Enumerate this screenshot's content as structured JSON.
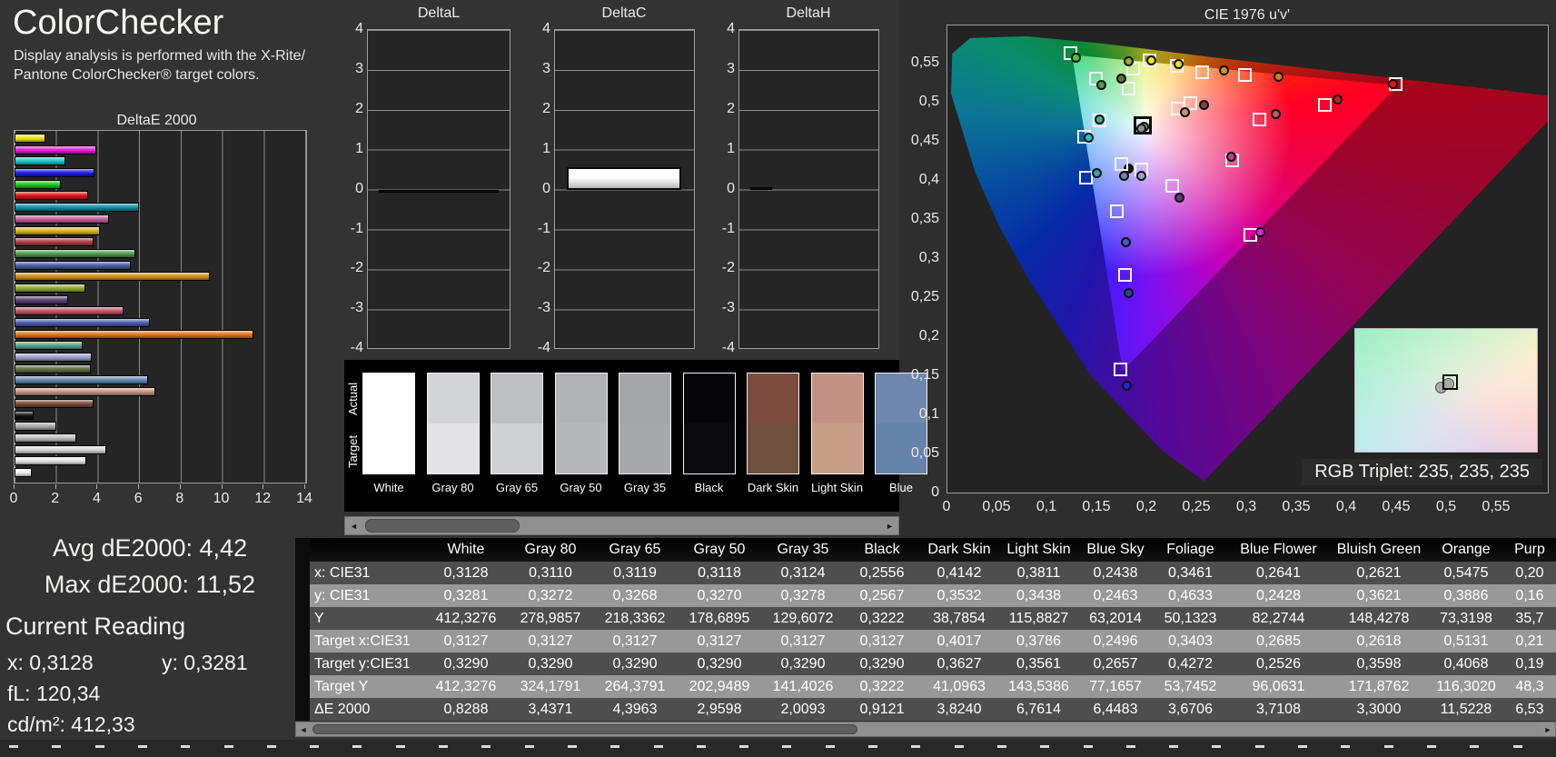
{
  "header": {
    "title": "ColorChecker",
    "subtitle_line1": "Display analysis is performed with the X-Rite/",
    "subtitle_line2": "Pantone ColorChecker® target colors."
  },
  "readings": {
    "avg": "Avg dE2000: 4,42",
    "max": "Max dE2000: 11,52",
    "current_title": "Current Reading",
    "x": "x: 0,3128",
    "y": "y: 0,3281",
    "fl": "fL: 120,34",
    "cd": "cd/m²: 412,33"
  },
  "icons": {
    "scroll_left": "◄",
    "scroll_right": "►"
  },
  "cie": {
    "title": "CIE 1976 u'v'",
    "rgb_triplet": "RGB Triplet: 235, 235, 235"
  },
  "swatch_strip": {
    "actual_label": "Actual",
    "target_label": "Target",
    "items": [
      {
        "name": "White",
        "actual": "#fefefe",
        "target": "#fdfdfd"
      },
      {
        "name": "Gray 80",
        "actual": "#d3d4d6",
        "target": "#e3e3e5"
      },
      {
        "name": "Gray 65",
        "actual": "#bdbfc1",
        "target": "#d0d1d3"
      },
      {
        "name": "Gray 50",
        "actual": "#b1b2b4",
        "target": "#b6b7b9"
      },
      {
        "name": "Gray 35",
        "actual": "#a4a5a7",
        "target": "#a8a9ab"
      },
      {
        "name": "Black",
        "actual": "#060608",
        "target": "#0b0b0d"
      },
      {
        "name": "Dark Skin",
        "actual": "#7d4a3e",
        "target": "#6f503f"
      },
      {
        "name": "Light Skin",
        "actual": "#c29184",
        "target": "#c99e88"
      },
      {
        "name": "Blue",
        "actual": "#6d87ae",
        "target": "#6583ab"
      }
    ]
  },
  "table": {
    "headers": [
      "White",
      "Gray 80",
      "Gray 65",
      "Gray 50",
      "Gray 35",
      "Black",
      "Dark Skin",
      "Light Skin",
      "Blue Sky",
      "Foliage",
      "Blue Flower",
      "Bluish Green",
      "Orange",
      "Purp"
    ],
    "rows": [
      {
        "label": "x: CIE31",
        "values": [
          "0,3128",
          "0,3110",
          "0,3119",
          "0,3118",
          "0,3124",
          "0,2556",
          "0,4142",
          "0,3811",
          "0,2438",
          "0,3461",
          "0,2641",
          "0,2621",
          "0,5475",
          "0,20"
        ]
      },
      {
        "label": "y: CIE31",
        "values": [
          "0,3281",
          "0,3272",
          "0,3268",
          "0,3270",
          "0,3278",
          "0,2567",
          "0,3532",
          "0,3438",
          "0,2463",
          "0,4633",
          "0,2428",
          "0,3621",
          "0,3886",
          "0,16"
        ]
      },
      {
        "label": "Y",
        "values": [
          "412,3276",
          "278,9857",
          "218,3362",
          "178,6895",
          "129,6072",
          "0,3222",
          "38,7854",
          "115,8827",
          "63,2014",
          "50,1323",
          "82,2744",
          "148,4278",
          "73,3198",
          "35,7"
        ]
      },
      {
        "label": "Target x:CIE31",
        "values": [
          "0,3127",
          "0,3127",
          "0,3127",
          "0,3127",
          "0,3127",
          "0,3127",
          "0,4017",
          "0,3786",
          "0,2496",
          "0,3403",
          "0,2685",
          "0,2618",
          "0,5131",
          "0,21"
        ]
      },
      {
        "label": "Target y:CIE31",
        "values": [
          "0,3290",
          "0,3290",
          "0,3290",
          "0,3290",
          "0,3290",
          "0,3290",
          "0,3627",
          "0,3561",
          "0,2657",
          "0,4272",
          "0,2526",
          "0,3598",
          "0,4068",
          "0,19"
        ]
      },
      {
        "label": "Target Y",
        "values": [
          "412,3276",
          "324,1791",
          "264,3791",
          "202,9489",
          "141,4026",
          "0,3222",
          "41,0963",
          "143,5386",
          "77,1657",
          "53,7452",
          "96,0631",
          "171,8762",
          "116,3020",
          "48,3"
        ]
      },
      {
        "label": "ΔE 2000",
        "values": [
          "0,8288",
          "3,4371",
          "4,3963",
          "2,9598",
          "2,0093",
          "0,9121",
          "3,8240",
          "6,7614",
          "6,4483",
          "3,6706",
          "3,7108",
          "3,3000",
          "11,5228",
          "6,53"
        ]
      }
    ]
  },
  "chart_data": [
    {
      "type": "bar",
      "title": "DeltaE 2000",
      "orientation": "horizontal",
      "xlim": [
        0,
        14
      ],
      "xticks": [
        0,
        2,
        4,
        6,
        8,
        10,
        12,
        14
      ],
      "grid": true,
      "bars": [
        {
          "color": "#ece81a",
          "value": 1.5
        },
        {
          "color": "#e01ddb",
          "value": 3.95
        },
        {
          "color": "#1ec8c8",
          "value": 2.45
        },
        {
          "color": "#1a1ae6",
          "value": 3.85
        },
        {
          "color": "#22c51f",
          "value": 2.25
        },
        {
          "color": "#e31215",
          "value": 3.55
        },
        {
          "color": "#0e8fa5",
          "value": 6.0
        },
        {
          "color": "#c45f9f",
          "value": 4.55
        },
        {
          "color": "#d9b51c",
          "value": 4.1
        },
        {
          "color": "#b03a44",
          "value": 3.8
        },
        {
          "color": "#4f9a48",
          "value": 5.8
        },
        {
          "color": "#4c59a8",
          "value": 5.6
        },
        {
          "color": "#d29219",
          "value": 9.4
        },
        {
          "color": "#93ac35",
          "value": 3.4
        },
        {
          "color": "#5d3f78",
          "value": 2.6
        },
        {
          "color": "#c25568",
          "value": 5.25
        },
        {
          "color": "#4a5cb0",
          "value": 6.53
        },
        {
          "color": "#e1761c",
          "value": 11.52
        },
        {
          "color": "#55a68c",
          "value": 3.3
        },
        {
          "color": "#9aa3cb",
          "value": 3.71
        },
        {
          "color": "#5e7140",
          "value": 3.67
        },
        {
          "color": "#6488b0",
          "value": 6.45
        },
        {
          "color": "#c99183",
          "value": 6.76
        },
        {
          "color": "#7c4b39",
          "value": 3.82
        },
        {
          "color": "#101010",
          "value": 0.91
        },
        {
          "color": "#a8a8a8",
          "value": 2.01
        },
        {
          "color": "#bdbdbd",
          "value": 2.96
        },
        {
          "color": "#d8d8d8",
          "value": 4.4
        },
        {
          "color": "#e8e8e8",
          "value": 3.44
        },
        {
          "color": "#f5f5f5",
          "value": 0.83
        }
      ]
    },
    {
      "type": "bar",
      "title": "DeltaL",
      "ylim": [
        -4,
        4
      ],
      "yticks": [
        4,
        3,
        2,
        1,
        0,
        -1,
        -2,
        -3,
        -4
      ],
      "value": -0.05,
      "bar_color": "#0c0c0c"
    },
    {
      "type": "bar",
      "title": "DeltaC",
      "ylim": [
        -4,
        4
      ],
      "yticks": [
        4,
        3,
        2,
        1,
        0,
        -1,
        -2,
        -3,
        -4
      ],
      "value": 0.55,
      "bar_color": "#ffffff"
    },
    {
      "type": "bar",
      "title": "DeltaH",
      "ylim": [
        -4,
        4
      ],
      "yticks": [
        4,
        3,
        2,
        1,
        0,
        -1,
        -2,
        -3,
        -4
      ],
      "value": 0.05,
      "bar_color": "#0c0c0c"
    },
    {
      "type": "scatter",
      "title": "CIE 1976 u'v'",
      "xlim": [
        0,
        0.6
      ],
      "ylim": [
        0,
        0.6
      ],
      "xticks": [
        "0",
        "0,05",
        "0,1",
        "0,15",
        "0,2",
        "0,25",
        "0,3",
        "0,35",
        "0,4",
        "0,45",
        "0,5",
        "0,55"
      ],
      "yticks": [
        "0,55",
        "0,5",
        "0,45",
        "0,4",
        "0,35",
        "0,3",
        "0,25",
        "0,2",
        "0,15",
        "0,1",
        "0,05",
        "0"
      ],
      "legend": "squares = target, dots = measured",
      "points": [
        {
          "n": "white",
          "c": "#9b9b9b",
          "t": [
            0.1978,
            0.4683
          ],
          "m": [
            0.1984,
            0.4676
          ],
          "hl": true
        },
        {
          "n": "gray",
          "c": "#8f8f8f",
          "m": [
            0.1962,
            0.466
          ]
        },
        {
          "n": "black",
          "c": "#161616",
          "m": [
            0.1836,
            0.4148
          ]
        },
        {
          "n": "dark-skin",
          "c": "#7d4a3e",
          "t": [
            0.2454,
            0.4985
          ],
          "m": [
            0.2585,
            0.4959
          ]
        },
        {
          "n": "light-skin",
          "c": "#c29184",
          "t": [
            0.2324,
            0.4918
          ],
          "m": [
            0.2396,
            0.4863
          ]
        },
        {
          "n": "blue-sky",
          "c": "#6d87ae",
          "t": [
            0.1755,
            0.4203
          ],
          "m": [
            0.1784,
            0.4054
          ]
        },
        {
          "n": "foliage",
          "c": "#5e7140",
          "t": [
            0.1828,
            0.5164
          ],
          "m": [
            0.176,
            0.53
          ]
        },
        {
          "n": "blue-flower",
          "c": "#9aa3cb",
          "t": [
            0.1955,
            0.4138
          ],
          "m": [
            0.1962,
            0.4058
          ]
        },
        {
          "n": "bluish-green",
          "c": "#55a68c",
          "t": [
            0.1541,
            0.4766
          ],
          "m": [
            0.1537,
            0.4778
          ]
        },
        {
          "n": "orange",
          "c": "#e1761c",
          "t": [
            0.2994,
            0.5341
          ],
          "m": [
            0.3334,
            0.5324
          ]
        },
        {
          "n": "purplish-blue",
          "c": "#4a5cb0",
          "t": [
            0.1713,
            0.3598
          ],
          "m": [
            0.1804,
            0.3203
          ]
        },
        {
          "n": "moderate-red",
          "c": "#c25568",
          "t": [
            0.3142,
            0.4776
          ],
          "m": [
            0.33,
            0.484
          ]
        },
        {
          "n": "purple",
          "c": "#5d3f78",
          "t": [
            0.227,
            0.392
          ],
          "m": [
            0.234,
            0.377
          ]
        },
        {
          "n": "yellow-green",
          "c": "#93ac35",
          "t": [
            0.188,
            0.543
          ],
          "m": [
            0.183,
            0.552
          ]
        },
        {
          "n": "orange-yellow",
          "c": "#d29219",
          "t": [
            0.257,
            0.538
          ],
          "m": [
            0.279,
            0.54
          ]
        },
        {
          "n": "blue",
          "c": "#2f3f9e",
          "t": [
            0.1792,
            0.2781
          ],
          "m": [
            0.183,
            0.255
          ]
        },
        {
          "n": "green",
          "c": "#4f9a48",
          "t": [
            0.1501,
            0.5294
          ],
          "m": [
            0.156,
            0.521
          ]
        },
        {
          "n": "red",
          "c": "#c22222",
          "t": [
            0.3797,
            0.4961
          ],
          "m": [
            0.392,
            0.503
          ]
        },
        {
          "n": "yellow",
          "c": "#e8e020",
          "t": [
            0.2314,
            0.5462
          ],
          "m": [
            0.2335,
            0.5478
          ]
        },
        {
          "n": "magenta",
          "c": "#c83896",
          "t": [
            0.287,
            0.425
          ],
          "m": [
            0.2862,
            0.43
          ]
        },
        {
          "n": "cyan",
          "c": "#38a0b4",
          "t": [
            0.14,
            0.4028
          ],
          "m": [
            0.1512,
            0.4082
          ]
        },
        {
          "n": "srgb-red",
          "c": "#e81212",
          "t": [
            0.4507,
            0.5229
          ],
          "m": [
            0.448,
            0.523
          ]
        },
        {
          "n": "srgb-green",
          "c": "#30d530",
          "t": [
            0.125,
            0.5625
          ],
          "m": [
            0.13,
            0.556
          ]
        },
        {
          "n": "srgb-blue",
          "c": "#2222e0",
          "t": [
            0.1754,
            0.1579
          ],
          "m": [
            0.1815,
            0.1365
          ]
        },
        {
          "n": "srgb-cyan",
          "c": "#22c8c8",
          "t": [
            0.1383,
            0.4554
          ],
          "m": [
            0.1432,
            0.4545
          ]
        },
        {
          "n": "srgb-magenta",
          "c": "#e022e0",
          "t": [
            0.305,
            0.3298
          ],
          "m": [
            0.3148,
            0.333
          ]
        },
        {
          "n": "srgb-yellow",
          "c": "#e8e818",
          "t": [
            0.2039,
            0.5529
          ],
          "m": [
            0.2058,
            0.5524
          ]
        }
      ]
    }
  ]
}
